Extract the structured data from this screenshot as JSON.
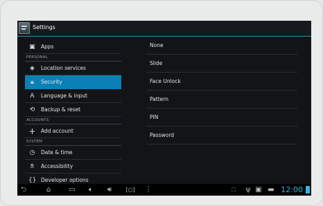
{
  "app": {
    "title": "Settings",
    "accent": "#33b5e5",
    "selected_color": "#0b80b4"
  },
  "sidebar": {
    "apps_label": "Apps",
    "personal_header": "PERSONAL",
    "location_label": "Location services",
    "security_label": "Security",
    "language_label": "Language & input",
    "backup_label": "Backup & reset",
    "accounts_header": "ACCOUNTS",
    "add_account_label": "Add account",
    "system_header": "SYSTEM",
    "date_time_label": "Date & time",
    "accessibility_label": "Accessibility",
    "developer_label": "Developer options"
  },
  "lock_options": [
    "None",
    "Slide",
    "Face Unlock",
    "Pattern",
    "PIN",
    "Password"
  ],
  "status": {
    "time": "12:00"
  }
}
